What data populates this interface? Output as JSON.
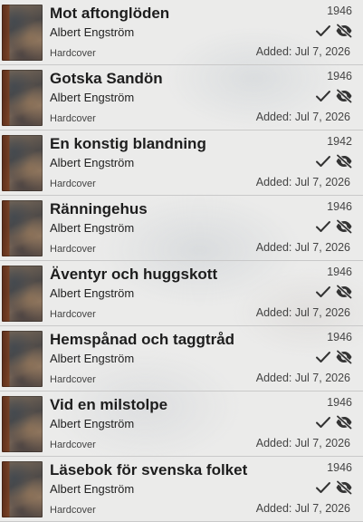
{
  "books": [
    {
      "title": "Mot aftonglöden",
      "author": "Albert Engström",
      "format": "Hardcover",
      "year": "1946",
      "added": "Added: Jul 7, 2026"
    },
    {
      "title": "Gotska Sandön",
      "author": "Albert Engström",
      "format": "Hardcover",
      "year": "1946",
      "added": "Added: Jul 7, 2026"
    },
    {
      "title": "En konstig blandning",
      "author": "Albert Engström",
      "format": "Hardcover",
      "year": "1942",
      "added": "Added: Jul 7, 2026"
    },
    {
      "title": "Ränningehus",
      "author": "Albert Engström",
      "format": "Hardcover",
      "year": "1946",
      "added": "Added: Jul 7, 2026"
    },
    {
      "title": "Äventyr och huggskott",
      "author": "Albert Engström",
      "format": "Hardcover",
      "year": "1946",
      "added": "Added: Jul 7, 2026"
    },
    {
      "title": "Hemspånad och taggtråd",
      "author": "Albert Engström",
      "format": "Hardcover",
      "year": "1946",
      "added": "Added: Jul 7, 2026"
    },
    {
      "title": "Vid en milstolpe",
      "author": "Albert Engström",
      "format": "Hardcover",
      "year": "1946",
      "added": "Added: Jul 7, 2026"
    },
    {
      "title": "Läsebok för svenska folket",
      "author": "Albert Engström",
      "format": "Hardcover",
      "year": "1946",
      "added": "Added: Jul 7, 2026"
    }
  ],
  "icons": {
    "owned": "checkmark-icon",
    "visibility": "eye-off-icon"
  },
  "colors": {
    "text": "#1d1d1d",
    "secondary": "#444444",
    "divider": "#c9c9c9"
  }
}
